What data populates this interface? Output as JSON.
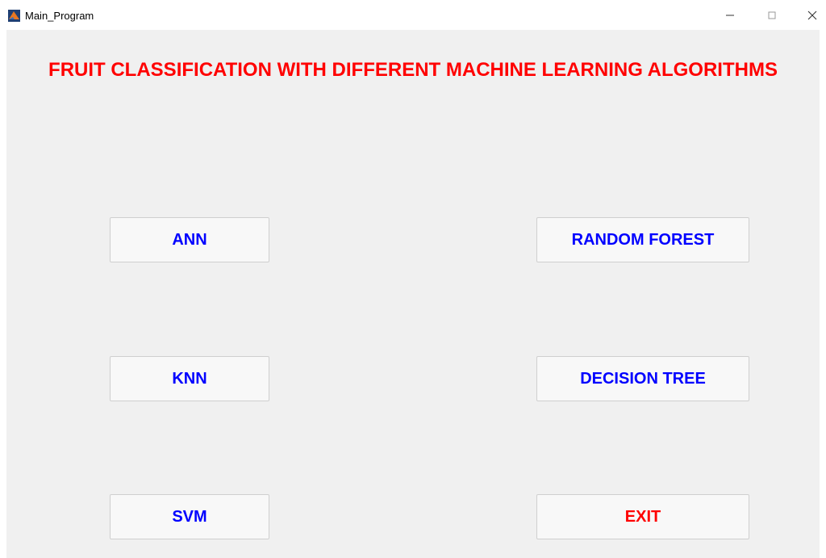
{
  "window": {
    "title": "Main_Program",
    "minimize": "–",
    "maximize": "□",
    "close": "✕"
  },
  "main": {
    "title": "FRUIT CLASSIFICATION WITH DIFFERENT MACHINE LEARNING ALGORITHMS",
    "buttons": {
      "ann": "ANN",
      "knn": "KNN",
      "svm": "SVM",
      "random_forest": "RANDOM FOREST",
      "decision_tree": "DECISION TREE",
      "exit": "EXIT"
    }
  },
  "colors": {
    "title": "#ff0000",
    "button_text": "#0000ff",
    "exit_text": "#ff0000",
    "background": "#f0f0f0"
  },
  "icons": {
    "app": "matlab-icon"
  }
}
